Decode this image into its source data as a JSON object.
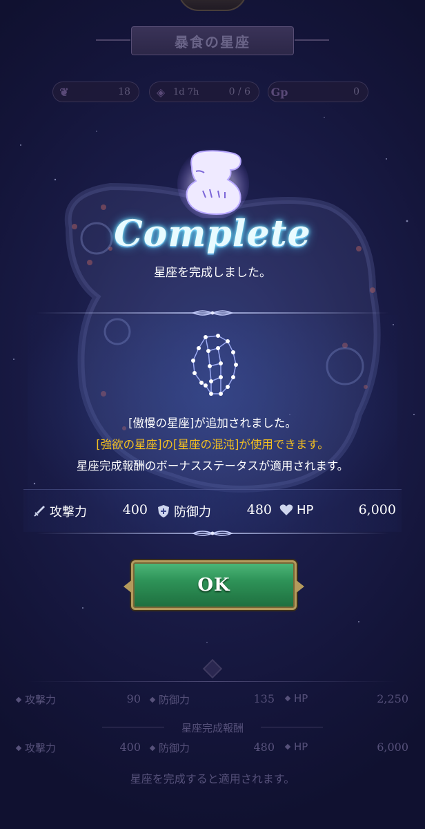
{
  "header": {
    "title": "暴食の星座",
    "stats": {
      "points": "18",
      "timer": "1d 7h",
      "progress": "0 / 6",
      "gp_label": "Gp",
      "gp_value": "0"
    }
  },
  "modal": {
    "title": "Complete",
    "subtitle": "星座を完成しました。",
    "messages": [
      "[傲慢の星座]が追加されました。",
      "[強欲の星座]の[星座の混沌]が使用できます。",
      "星座完成報酬のボーナスステータスが適用されます。"
    ],
    "bonus": [
      {
        "label": "攻撃力",
        "value": "400",
        "icon": "sword-icon"
      },
      {
        "label": "防御力",
        "value": "480",
        "icon": "shield-icon"
      },
      {
        "label": "HP",
        "value": "6,000",
        "icon": "heart-icon"
      }
    ],
    "ok_label": "OK"
  },
  "background_panel": {
    "current": [
      {
        "label": "攻撃力",
        "value": "90"
      },
      {
        "label": "防御力",
        "value": "135"
      },
      {
        "label": "HP",
        "value": "2,250"
      }
    ],
    "reward_label": "星座完成報酬",
    "reward": [
      {
        "label": "攻撃力",
        "value": "400"
      },
      {
        "label": "防御力",
        "value": "480"
      },
      {
        "label": "HP",
        "value": "6,000"
      }
    ],
    "note": "星座を完成すると適用されます。"
  },
  "colors": {
    "highlight_text": "#f4c020",
    "title_glow": "#7ff3ff",
    "button_green": "#2e9358",
    "button_border": "#b49a5c"
  }
}
